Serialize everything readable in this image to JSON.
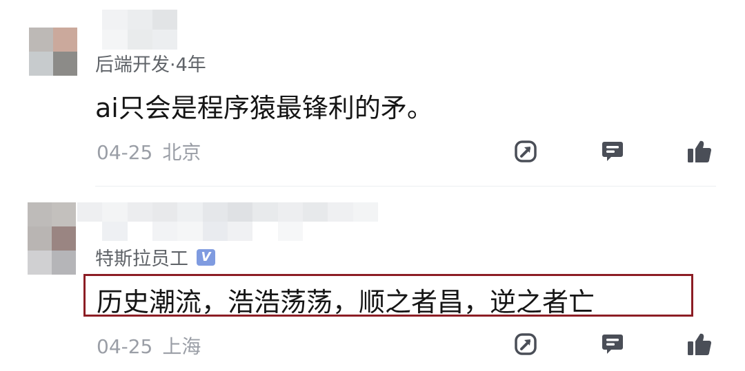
{
  "comments": [
    {
      "user_tag": "后端开发·4年",
      "verified": false,
      "text": "ai只会是程序猿最锋利的矛。",
      "date": "04-25",
      "location": "北京",
      "avatar_mosaic": [
        "#bdb9b6",
        "#cba99c",
        "#c7cbcd",
        "#8c8b88"
      ],
      "name_mosaic": [
        "#ffffff",
        "#f1f2f4",
        "#ebedef",
        "#e2e4e6",
        "#ffffff",
        "#f4f5f6",
        "#e9ebec",
        "#eceef0"
      ],
      "actions": {
        "share": "share-icon",
        "reply": "reply-icon",
        "like": "thumbs-up-icon"
      }
    },
    {
      "user_tag": "特斯拉员工",
      "verified": true,
      "verified_badge": "V",
      "text": "历史潮流，浩浩荡荡，顺之者昌，逆之者亡",
      "date": "04-25",
      "location": "上海",
      "avatar_mosaic": [
        "#bebbb9",
        "#c3c0bd",
        "#b9b5b3",
        "#9a8582",
        "#d0d0d2",
        "#b5b5b8"
      ],
      "name_mosaic": [
        "#eeeff1",
        "#f3f4f5",
        "#ecedef",
        "#e8e9eb",
        "#eef0f2",
        "#e5e7ea",
        "#dfe1e4",
        "#e8eaec",
        "#edeef0",
        "#e7e9eb",
        "#eff0f2",
        "#f3f4f5",
        "#ffffff",
        "#eef0f3",
        "#ffffff",
        "#f2f3f5",
        "#f5f6f7",
        "#e9ebef",
        "#f0f1f3",
        "#ffffff",
        "#f6f7f8",
        "#ffffff",
        "#ffffff",
        "#ffffff"
      ],
      "highlighted": true,
      "actions": {
        "share": "share-icon",
        "reply": "reply-icon",
        "like": "thumbs-up-icon"
      }
    }
  ],
  "colors": {
    "icon": "#4a4e57",
    "meta_text": "#9a9ea6",
    "highlight_border": "#8c1d24",
    "verified_badge": "#7f9be0"
  }
}
